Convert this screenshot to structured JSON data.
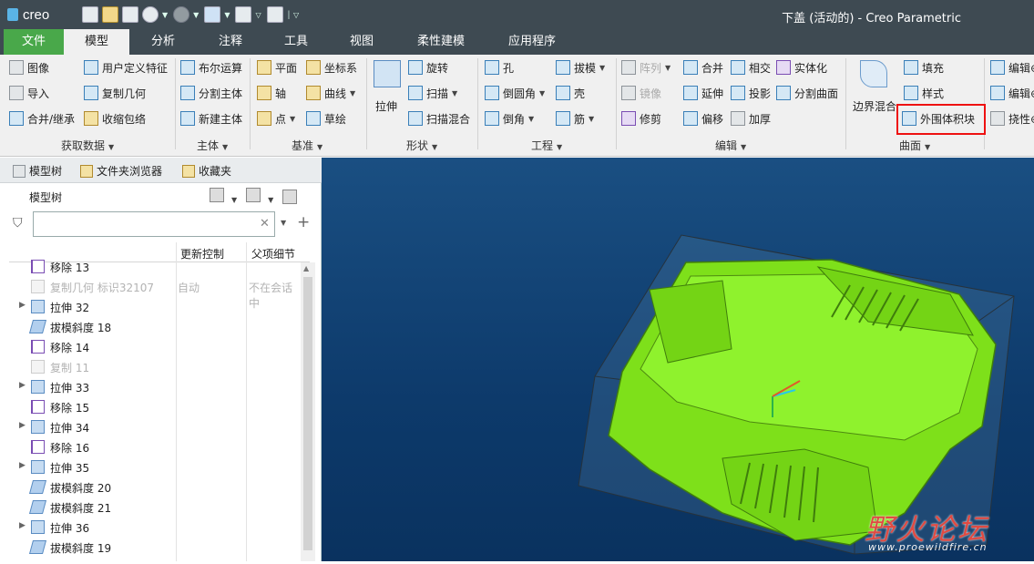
{
  "app": {
    "logo": "creo",
    "title": "下盖 (活动的) - Creo Parametric"
  },
  "tabs": [
    {
      "label": "文件"
    },
    {
      "label": "模型"
    },
    {
      "label": "分析"
    },
    {
      "label": "注释"
    },
    {
      "label": "工具"
    },
    {
      "label": "视图"
    },
    {
      "label": "柔性建模"
    },
    {
      "label": "应用程序"
    }
  ],
  "ribbon": {
    "get_data": {
      "label": "获取数据",
      "items": [
        "图像",
        "用户定义特征",
        "导入",
        "复制几何",
        "合并/继承",
        "收缩包络"
      ]
    },
    "body": {
      "label": "主体",
      "items": [
        "布尔运算",
        "分割主体",
        "新建主体"
      ]
    },
    "datum": {
      "label": "基准",
      "items": [
        "平面",
        "坐标系",
        "轴",
        "曲线",
        "点",
        "草绘"
      ]
    },
    "shapes": {
      "label": "形状",
      "items": [
        "拉伸",
        "旋转",
        "扫描",
        "扫描混合"
      ]
    },
    "engineering": {
      "label": "工程",
      "items": [
        "孔",
        "拔模",
        "倒圆角",
        "壳",
        "倒角",
        "筋"
      ]
    },
    "editing": {
      "label": "编辑",
      "items": [
        "阵列",
        "合并",
        "相交",
        "实体化",
        "镜像",
        "延伸",
        "投影",
        "分割曲面",
        "修剪",
        "偏移",
        "加厚"
      ]
    },
    "surfaces": {
      "label": "曲面",
      "items": [
        "边界混合",
        "填充",
        "样式",
        "外围体积块"
      ],
      "highlighted": "外围体积块"
    },
    "partial": {
      "items": [
        "编辑⊕",
        "编辑⊕",
        "挠性⊕"
      ]
    }
  },
  "left_panel": {
    "tabs": [
      "模型树",
      "文件夹浏览器",
      "收藏夹"
    ],
    "tree_title": "模型树",
    "search_value": "",
    "columns": [
      "更新控制",
      "父项细节"
    ],
    "rows": [
      {
        "name": "移除 13",
        "type": "cut",
        "expand": false,
        "dim": false,
        "c2": "",
        "c3": ""
      },
      {
        "name": "复制几何 标识32107",
        "type": "dis",
        "expand": false,
        "dim": true,
        "c2": "自动",
        "c3": "不在会话中"
      },
      {
        "name": "拉伸 32",
        "type": "ext",
        "expand": true,
        "dim": false,
        "c2": "",
        "c3": ""
      },
      {
        "name": "拔模斜度 18",
        "type": "draft",
        "expand": false,
        "dim": false,
        "c2": "",
        "c3": ""
      },
      {
        "name": "移除 14",
        "type": "cut",
        "expand": false,
        "dim": false,
        "c2": "",
        "c3": ""
      },
      {
        "name": "复制 11",
        "type": "dis",
        "expand": false,
        "dim": true,
        "c2": "",
        "c3": ""
      },
      {
        "name": "拉伸 33",
        "type": "ext",
        "expand": true,
        "dim": false,
        "c2": "",
        "c3": ""
      },
      {
        "name": "移除 15",
        "type": "cut",
        "expand": false,
        "dim": false,
        "c2": "",
        "c3": ""
      },
      {
        "name": "拉伸 34",
        "type": "ext",
        "expand": true,
        "dim": false,
        "c2": "",
        "c3": ""
      },
      {
        "name": "移除 16",
        "type": "cut",
        "expand": false,
        "dim": false,
        "c2": "",
        "c3": ""
      },
      {
        "name": "拉伸 35",
        "type": "ext",
        "expand": true,
        "dim": false,
        "c2": "",
        "c3": ""
      },
      {
        "name": "拔模斜度 20",
        "type": "draft",
        "expand": false,
        "dim": false,
        "c2": "",
        "c3": ""
      },
      {
        "name": "拔模斜度 21",
        "type": "draft",
        "expand": false,
        "dim": false,
        "c2": "",
        "c3": ""
      },
      {
        "name": "拉伸 36",
        "type": "ext",
        "expand": true,
        "dim": false,
        "c2": "",
        "c3": ""
      },
      {
        "name": "拔模斜度 19",
        "type": "draft",
        "expand": false,
        "dim": false,
        "c2": "",
        "c3": ""
      }
    ]
  },
  "watermark": {
    "text": "野火论坛",
    "url": "www.proewildfire.cn"
  },
  "colors": {
    "accent_green": "#49a84a",
    "titlebar": "#3e4a52",
    "part_green": "#7ee01a",
    "viewport_blue": "#0d3a6b",
    "highlight_red": "#e11111"
  }
}
